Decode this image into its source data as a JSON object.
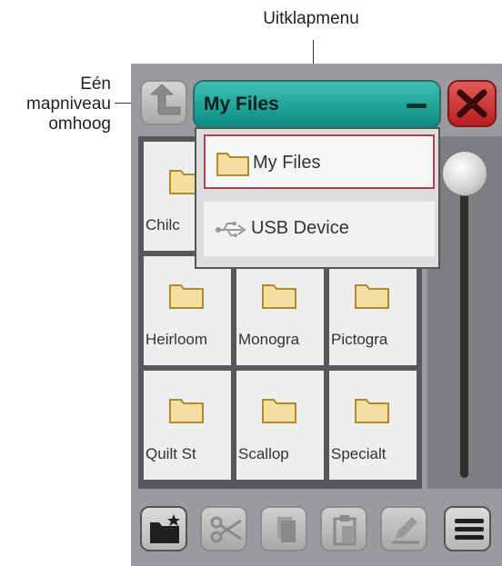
{
  "annotations": {
    "dropdown_label": "Uitklapmenu",
    "up_level_label": "Eén mapniveau omhoog"
  },
  "title_bar": {
    "title": "My Files"
  },
  "dropdown": {
    "items": [
      {
        "label": "My Files",
        "icon": "folder-icon",
        "selected": true
      },
      {
        "label": "USB Device",
        "icon": "usb-icon",
        "selected": false
      }
    ]
  },
  "folders": [
    {
      "label": "Chilc"
    },
    {
      "label": ""
    },
    {
      "label": ""
    },
    {
      "label": "Heirloom"
    },
    {
      "label": "Monogra"
    },
    {
      "label": "Pictogra"
    },
    {
      "label": "Quilt St"
    },
    {
      "label": "Scallop"
    },
    {
      "label": "Specialt"
    }
  ],
  "toolbar": {
    "buttons": [
      "new-folder-icon",
      "cut-icon",
      "copy-icon",
      "paste-icon",
      "rename-icon",
      "menu-icon"
    ]
  },
  "colors": {
    "title_bar": "#1aa89c",
    "close": "#cf3030",
    "folder": "#f3dfa0",
    "selected_border": "#b0405a"
  }
}
